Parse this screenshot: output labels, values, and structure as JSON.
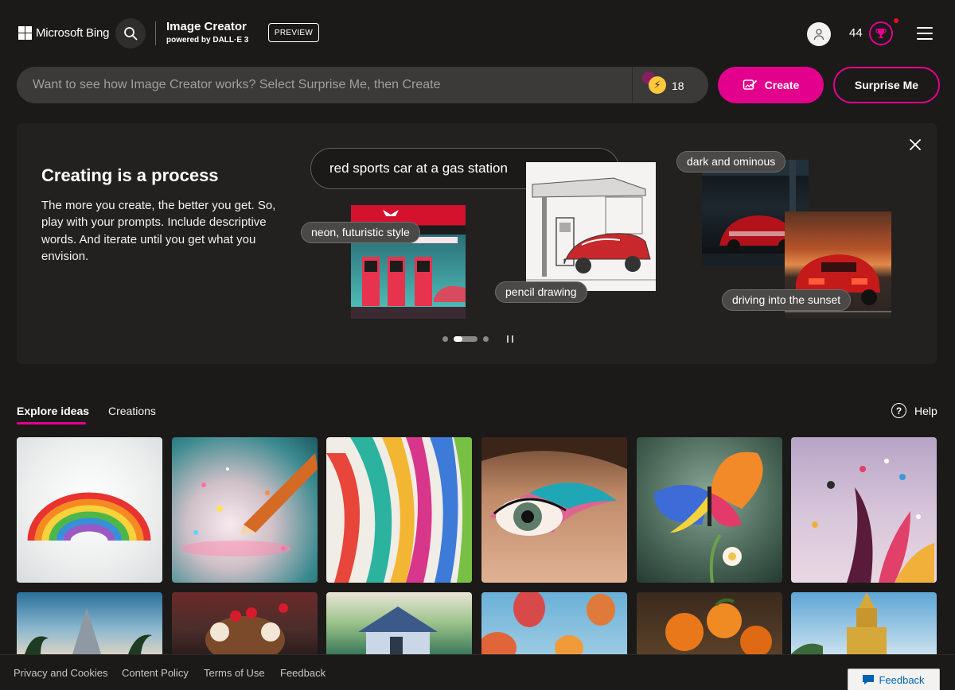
{
  "header": {
    "brand": "Microsoft Bing",
    "app_title": "Image Creator",
    "app_subtitle": "powered by DALL·E 3",
    "badge": "PREVIEW",
    "rewards_points": "44",
    "icons": [
      "windows-logo-icon",
      "search-icon",
      "user-icon",
      "trophy-icon",
      "hamburger-menu-icon"
    ]
  },
  "prompt": {
    "placeholder": "Want to see how Image Creator works? Select Surprise Me, then Create",
    "boosts": "18",
    "create_label": "Create",
    "surprise_label": "Surprise Me"
  },
  "promo": {
    "title": "Creating is a process",
    "text": "The more you create, the better you get. So, play with your prompts. Include descriptive words. And iterate until you get what you envision.",
    "example_prompt": "red sports car at a gas station",
    "chips": {
      "neon": "neon, futuristic style",
      "pencil": "pencil drawing",
      "dark": "dark and ominous",
      "sunset": "driving into the sunset"
    },
    "carousel_pages": 3,
    "carousel_active": 2
  },
  "tabs": {
    "explore": "Explore ideas",
    "creations": "Creations",
    "help": "Help"
  },
  "gallery": [
    {
      "name": "rainbow"
    },
    {
      "name": "pencil-sparkles"
    },
    {
      "name": "ribbons"
    },
    {
      "name": "eye-makeup"
    },
    {
      "name": "butterfly"
    },
    {
      "name": "paint-splash"
    },
    {
      "name": "palm-tree"
    },
    {
      "name": "ice-cream"
    },
    {
      "name": "cottage"
    },
    {
      "name": "hot-air-balloons"
    },
    {
      "name": "oranges"
    },
    {
      "name": "golden-temple"
    }
  ],
  "footer": {
    "privacy": "Privacy and Cookies",
    "content_policy": "Content Policy",
    "terms": "Terms of Use",
    "feedback_link": "Feedback",
    "feedback_button": "Feedback"
  },
  "colors": {
    "background": "#1b1a19",
    "accent": "#e3008c",
    "card": "#222120",
    "input": "#3b3a39"
  }
}
